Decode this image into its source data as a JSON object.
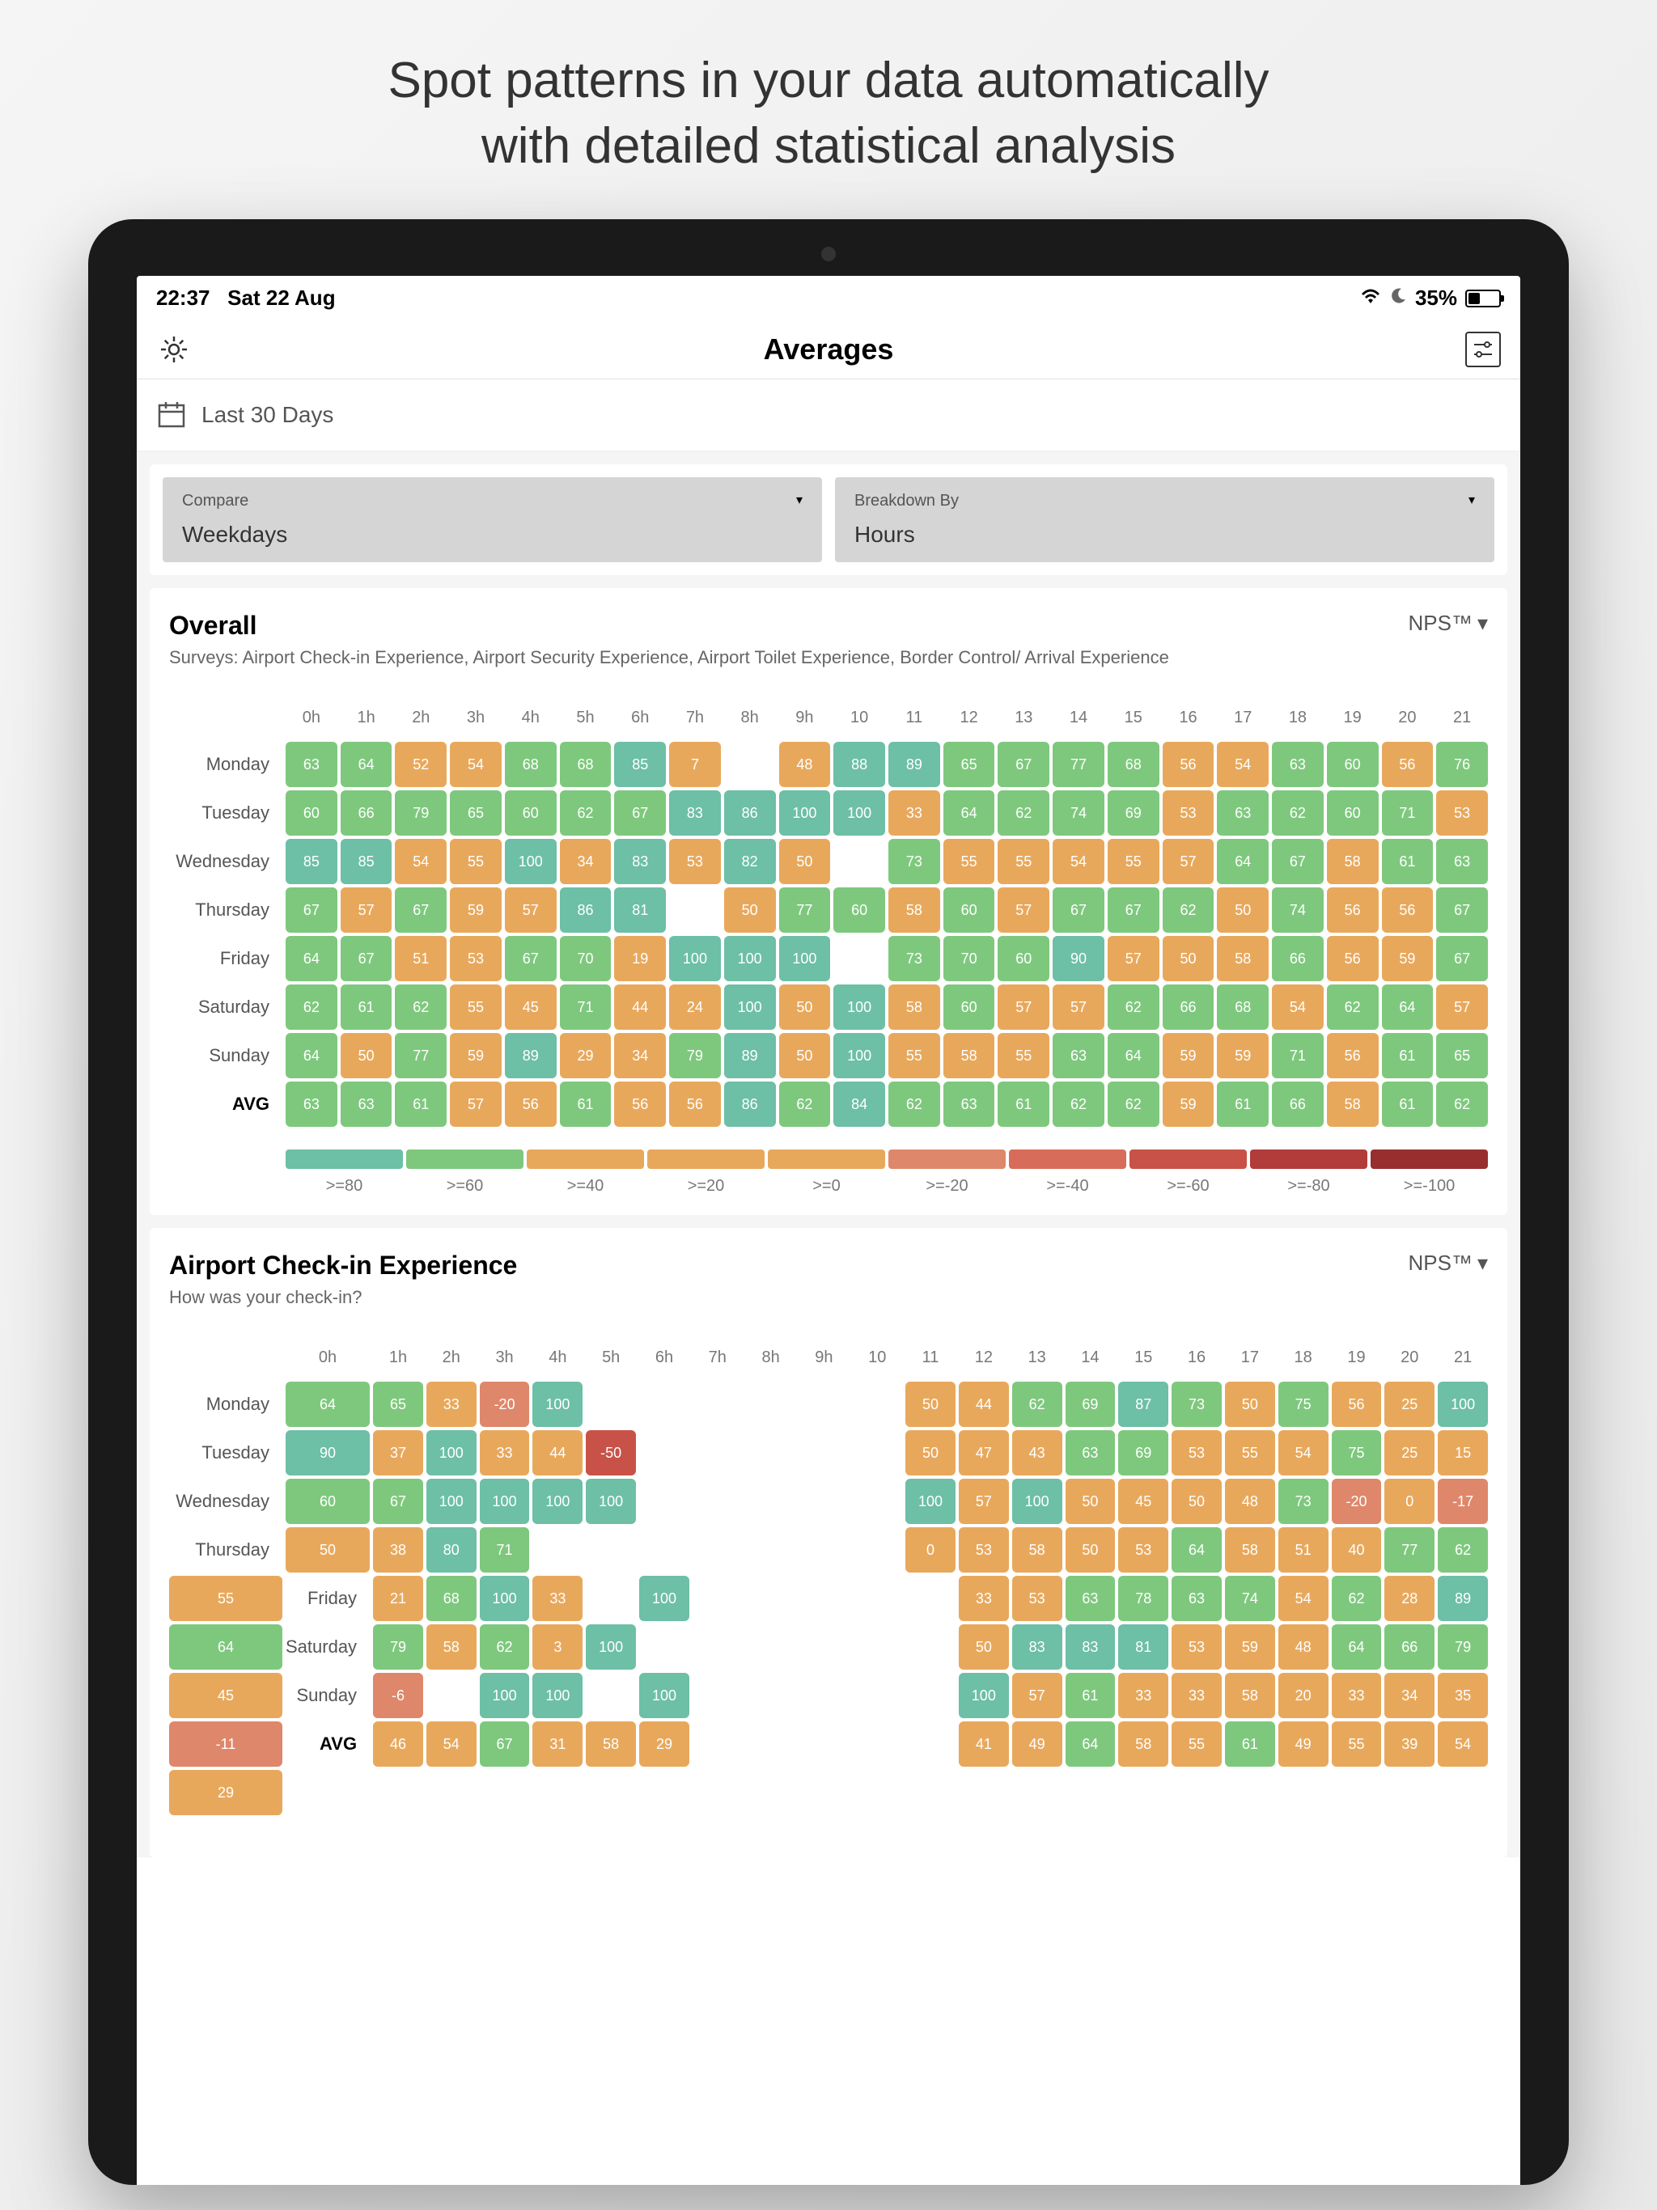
{
  "marketing": {
    "line1": "Spot patterns in your data automatically",
    "line2": "with detailed statistical analysis"
  },
  "status_bar": {
    "time": "22:37",
    "date": "Sat 22 Aug",
    "battery_pct": "35%"
  },
  "header": {
    "title": "Averages"
  },
  "date_range": {
    "label": "Last 30 Days"
  },
  "filters": {
    "compare": {
      "label": "Compare",
      "value": "Weekdays"
    },
    "breakdown": {
      "label": "Breakdown By",
      "value": "Hours"
    }
  },
  "columns": [
    "0h",
    "1h",
    "2h",
    "3h",
    "4h",
    "5h",
    "6h",
    "7h",
    "8h",
    "9h",
    "10",
    "11",
    "12",
    "13",
    "14",
    "15",
    "16",
    "17",
    "18",
    "19",
    "20",
    "21"
  ],
  "days": [
    "Monday",
    "Tuesday",
    "Wednesday",
    "Thursday",
    "Friday",
    "Saturday",
    "Sunday"
  ],
  "avg_label": "AVG",
  "metric_label": "NPS™",
  "legend": [
    {
      "label": ">=80",
      "color": "#6DBFA6"
    },
    {
      "label": ">=60",
      "color": "#7EC87E"
    },
    {
      "label": ">=40",
      "color": "#E8A85C"
    },
    {
      "label": ">=20",
      "color": "#E8A85C"
    },
    {
      "label": ">=0",
      "color": "#E8A85C"
    },
    {
      "label": ">=-20",
      "color": "#DF876A"
    },
    {
      "label": ">=-40",
      "color": "#D86C5A"
    },
    {
      "label": ">=-60",
      "color": "#C85248"
    },
    {
      "label": ">=-80",
      "color": "#B23C3A"
    },
    {
      "label": ">=-100",
      "color": "#992E2E"
    }
  ],
  "sections": [
    {
      "title": "Overall",
      "subtitle": "Surveys: Airport Check-in Experience, Airport Security Experience, Airport Toilet Experience, Border Control/ Arrival Experience",
      "rows": [
        [
          63,
          64,
          52,
          54,
          68,
          68,
          85,
          7,
          null,
          48,
          88,
          89,
          65,
          67,
          77,
          68,
          56,
          54,
          63,
          60,
          56,
          76
        ],
        [
          60,
          66,
          79,
          65,
          60,
          62,
          67,
          83,
          86,
          100,
          100,
          33,
          64,
          62,
          74,
          69,
          53,
          63,
          62,
          60,
          71,
          53
        ],
        [
          85,
          85,
          54,
          55,
          100,
          34,
          83,
          53,
          82,
          50,
          null,
          73,
          55,
          55,
          54,
          55,
          57,
          64,
          67,
          58,
          61,
          63
        ],
        [
          67,
          57,
          67,
          59,
          57,
          86,
          81,
          null,
          50,
          77,
          60,
          58,
          60,
          57,
          67,
          67,
          62,
          50,
          74,
          56,
          56,
          67
        ],
        [
          64,
          67,
          51,
          53,
          67,
          70,
          19,
          100,
          100,
          100,
          null,
          73,
          70,
          60,
          90,
          57,
          50,
          58,
          66,
          56,
          59,
          67
        ],
        [
          62,
          61,
          62,
          55,
          45,
          71,
          44,
          24,
          100,
          50,
          100,
          58,
          60,
          57,
          57,
          62,
          66,
          68,
          54,
          62,
          64,
          57
        ],
        [
          64,
          50,
          77,
          59,
          89,
          29,
          34,
          79,
          89,
          50,
          100,
          55,
          58,
          55,
          63,
          64,
          59,
          59,
          71,
          56,
          61,
          65
        ],
        [
          63,
          63,
          61,
          57,
          56,
          61,
          56,
          56,
          86,
          62,
          84,
          62,
          63,
          61,
          62,
          62,
          59,
          61,
          66,
          58,
          61,
          62
        ]
      ]
    },
    {
      "title": "Airport Check-in Experience",
      "subtitle": "How was your check-in?",
      "rows": [
        [
          64,
          65,
          33,
          -20,
          100,
          null,
          null,
          null,
          null,
          null,
          null,
          50,
          44,
          62,
          69,
          87,
          73,
          50,
          75,
          56,
          25,
          100
        ],
        [
          90,
          37,
          100,
          33,
          44,
          -50,
          null,
          null,
          null,
          null,
          null,
          50,
          47,
          43,
          63,
          69,
          53,
          55,
          54,
          75,
          25,
          15
        ],
        [
          60,
          67,
          100,
          100,
          100,
          100,
          null,
          null,
          null,
          null,
          null,
          100,
          57,
          100,
          50,
          45,
          50,
          48,
          73,
          -20,
          0,
          -17
        ],
        [
          50,
          38,
          80,
          71,
          null,
          null,
          null,
          null,
          null,
          null,
          null,
          0,
          53,
          58,
          50,
          53,
          64,
          58,
          51,
          40,
          77,
          62,
          55
        ],
        [
          21,
          68,
          100,
          33,
          null,
          100,
          null,
          null,
          null,
          null,
          null,
          33,
          53,
          63,
          78,
          63,
          74,
          54,
          62,
          28,
          89,
          64
        ],
        [
          79,
          58,
          62,
          3,
          100,
          null,
          null,
          null,
          null,
          null,
          null,
          50,
          83,
          83,
          81,
          53,
          59,
          48,
          64,
          66,
          79,
          45
        ],
        [
          -6,
          null,
          100,
          100,
          null,
          100,
          null,
          null,
          null,
          null,
          null,
          100,
          57,
          61,
          33,
          33,
          58,
          20,
          33,
          34,
          35,
          -11
        ],
        [
          46,
          54,
          67,
          31,
          58,
          29,
          null,
          null,
          null,
          null,
          null,
          41,
          49,
          64,
          58,
          55,
          61,
          49,
          55,
          39,
          54,
          29
        ]
      ]
    }
  ]
}
